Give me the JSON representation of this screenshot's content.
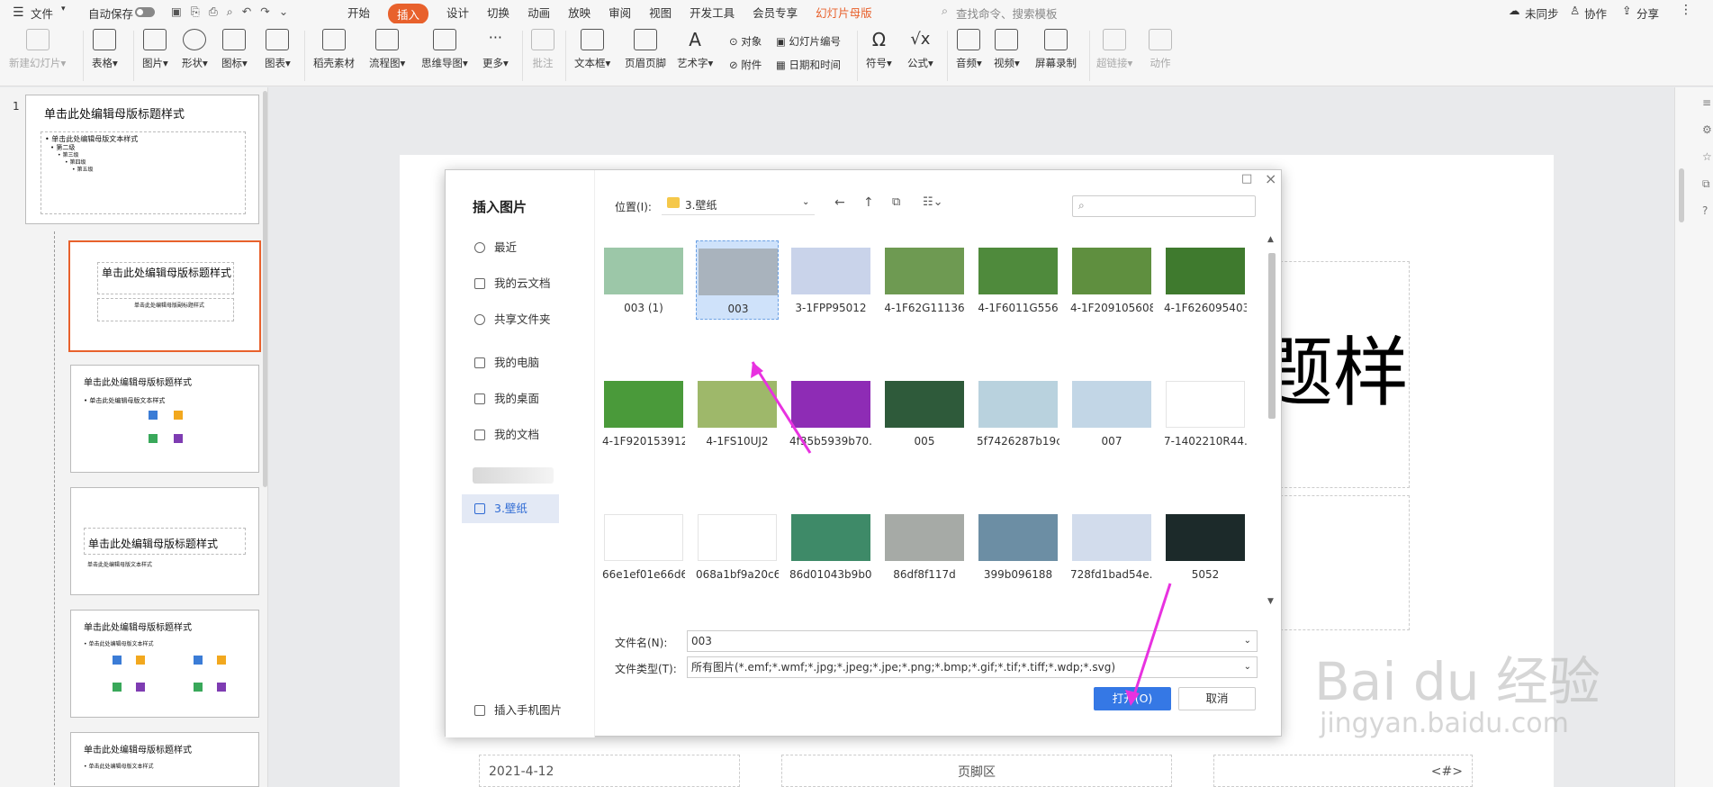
{
  "menubar": {
    "file": "文件",
    "autosave": "自动保存",
    "tabs": [
      "开始",
      "插入",
      "设计",
      "切换",
      "动画",
      "放映",
      "审阅",
      "视图",
      "开发工具",
      "会员专享",
      "幻灯片母版"
    ],
    "active_tab": "插入",
    "search_placeholder": "查找命令、搜索模板",
    "sync": "未同步",
    "collab": "协作",
    "share": "分享"
  },
  "ribbon": {
    "new_slide": "新建幻灯片",
    "table": "表格",
    "picture": "图片",
    "shape": "形状",
    "icon": "图标",
    "chart": "图表",
    "material": "稻壳素材",
    "flowchart": "流程图",
    "mindmap": "思维导图",
    "more": "更多",
    "comment": "批注",
    "textbox": "文本框",
    "header_footer": "页眉页脚",
    "wordart": "艺术字",
    "object": "对象",
    "attachment": "附件",
    "slide_number": "幻灯片编号",
    "datetime": "日期和时间",
    "symbol": "符号",
    "formula": "公式",
    "audio": "音频",
    "video": "视频",
    "screen_record": "屏幕录制",
    "hyperlink": "超链接",
    "action": "动作"
  },
  "thumbs": {
    "slide_number": "1",
    "master_title": "单击此处编辑母版标题样式",
    "master_text": "• 单击此处编辑母版文本样式",
    "level2": "• 第二级",
    "level3": "• 第三级",
    "level4": "• 第四级",
    "level5": "• 第五级",
    "layout1_title": "单击此处编辑母版标题样式",
    "layout1_sub": "单击此处编辑母版副标题样式",
    "layout2_title": "单击此处编辑母版标题样式",
    "layout2_text": "• 单击此处编辑母版文本样式",
    "layout3_title": "单击此处编辑母版标题样式",
    "layout3_text": "单击此处编辑母版文本样式",
    "layout4_title": "单击此处编辑母版标题样式",
    "layout4_text": "• 单击此处编辑母版文本样式",
    "layout5_title": "单击此处编辑母版标题样式",
    "layout5_text": "• 单击此处编辑母版文本样式"
  },
  "canvas": {
    "title_fragment": "题样",
    "date": "2021-4-12",
    "footer": "页脚区",
    "page_num": "<#>"
  },
  "dialog": {
    "title": "插入图片",
    "location_label": "位置(I):",
    "location_value": "3.壁纸",
    "search_placeholder": "",
    "nav": [
      {
        "label": "最近",
        "icon": "clock-icon"
      },
      {
        "label": "我的云文档",
        "icon": "cloud-icon"
      },
      {
        "label": "共享文件夹",
        "icon": "share-icon"
      },
      {
        "label": "我的电脑",
        "icon": "computer-icon"
      },
      {
        "label": "我的桌面",
        "icon": "desktop-icon"
      },
      {
        "label": "我的文档",
        "icon": "documents-icon"
      },
      {
        "label": "3.壁纸",
        "icon": "folder-icon"
      }
    ],
    "files": [
      {
        "name": "003 (1)",
        "color": "#9cc7a8"
      },
      {
        "name": "003",
        "color": "#a9b3bd"
      },
      {
        "name": "3-1FPP95012",
        "color": "#c9d3ea"
      },
      {
        "name": "4-1F62G11136",
        "color": "#6e9a52"
      },
      {
        "name": "4-1F6011G556",
        "color": "#4f8a3c"
      },
      {
        "name": "4-1F209105608",
        "color": "#5f8f3f"
      },
      {
        "name": "4-1F626095403",
        "color": "#3f7a2e"
      },
      {
        "name": "4-1F920153912",
        "color": "#4a9a3a"
      },
      {
        "name": "4-1FS10UJ2",
        "color": "#9eb86a"
      },
      {
        "name": "4f35b5939b70...",
        "color": "#8e2cb5"
      },
      {
        "name": "005",
        "color": "#2e5a3a"
      },
      {
        "name": "5f7426287b19c",
        "color": "#b9d2de"
      },
      {
        "name": "007",
        "color": "#c2d6e6"
      },
      {
        "name": "7-1402210R44...",
        "color": "#ffffff"
      },
      {
        "name": "66e1ef01e66d6...",
        "color": "#ffffff"
      },
      {
        "name": "068a1bf9a20c6...",
        "color": "#ffffff"
      },
      {
        "name": "86d01043b9b0...",
        "color": "#3e8a68"
      },
      {
        "name": "86df8f117d",
        "color": "#a6aaa6"
      },
      {
        "name": "399b096188",
        "color": "#6c8ea4"
      },
      {
        "name": "728fd1bad54e...",
        "color": "#d2dcec"
      },
      {
        "name": "5052",
        "color": "#1c2a2a"
      }
    ],
    "filename_label": "文件名(N):",
    "filename_value": "003",
    "filetype_label": "文件类型(T):",
    "filetype_value": "所有图片(*.emf;*.wmf;*.jpg;*.jpeg;*.jpe;*.png;*.bmp;*.gif;*.tif;*.tiff;*.wdp;*.svg)",
    "open_button": "打开(O)",
    "cancel_button": "取消",
    "phone_insert": "插入手机图片"
  },
  "watermark": {
    "brand": "Bai du 经验",
    "url": "jingyan.baidu.com"
  }
}
